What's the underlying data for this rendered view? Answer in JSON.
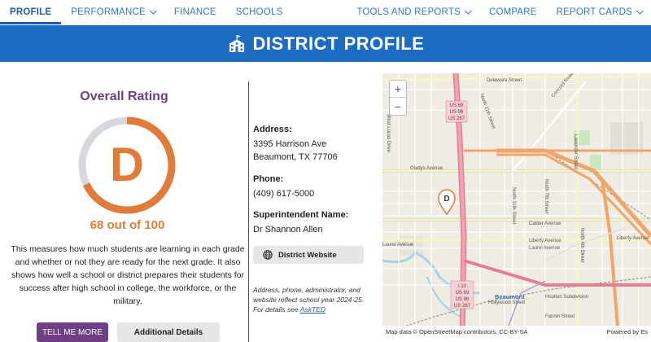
{
  "nav": {
    "left": [
      {
        "label": "PROFILE",
        "active": true,
        "dropdown": false
      },
      {
        "label": "PERFORMANCE",
        "active": false,
        "dropdown": true
      },
      {
        "label": "FINANCE",
        "active": false,
        "dropdown": false
      },
      {
        "label": "SCHOOLS",
        "active": false,
        "dropdown": false
      }
    ],
    "right": [
      {
        "label": "TOOLS AND REPORTS",
        "dropdown": true
      },
      {
        "label": "COMPARE",
        "dropdown": false
      },
      {
        "label": "REPORT CARDS",
        "dropdown": true
      }
    ]
  },
  "banner": {
    "title": "DISTRICT PROFILE",
    "icon": "school-building-icon"
  },
  "rating": {
    "title": "Overall Rating",
    "grade": "D",
    "score_text": "68 out of 100",
    "score": 68,
    "max": 100,
    "description": "This measures how much students are learning in each grade and whether or not they are ready for the next grade. It also shows how well a school or district prepares their students for success after high school in college, the workforce, or the military.",
    "tell_me_more": "TELL ME MORE",
    "additional_details": "Additional Details"
  },
  "info": {
    "address_label": "Address:",
    "address_line1": "3395 Harrison Ave",
    "address_line2": "Beaumont, TX 77706",
    "phone_label": "Phone:",
    "phone": "(409) 617-5000",
    "superintendent_label": "Superintendent Name:",
    "superintendent": "Dr Shannon Allen",
    "website_button": "District Website",
    "note_text": "Address, phone, administrator, and website reflect school year 2024-25. For details see ",
    "note_link": "AskTED"
  },
  "map": {
    "zoom_in": "+",
    "zoom_out": "−",
    "marker_letter": "D",
    "attribution": "Map data © OpenStreetMap contributors, CC-BY-SA",
    "powered_by": "Powered by Es",
    "labels": {
      "delaware": "Delaware Street",
      "concord": "Concord Road",
      "north11": "North 11th Street",
      "westlucas": "West Lucas Drive",
      "gladys": "Gladys Avenue",
      "calder": "Calder Avenue",
      "liberty": "Liberty Avenue",
      "laurel": "Laurel Avenue",
      "laurel2": "Laurel Avenue",
      "liberty2": "Liberty Avenue",
      "beaumont": "Beaumont",
      "hollywood": "Hollywood Street",
      "houlton": "Houlton Subdivision",
      "fannin": "Fannin Street",
      "us69a": "US 69",
      "us96a": "US 96",
      "us287a": "US 287",
      "i10": "I 10",
      "us69b": "US 69",
      "us96b": "US 96",
      "us287b": "US 287",
      "n7th": "North 7th Street",
      "n4th": "North 4th Street",
      "n11b": "North 11th Street",
      "lavender": "Lavender Street"
    }
  },
  "colors": {
    "primary_blue": "#1d6cc4",
    "rating_purple": "#6f3f86",
    "rating_orange": "#e07b3a",
    "gauge_track": "#d5d8dc"
  }
}
